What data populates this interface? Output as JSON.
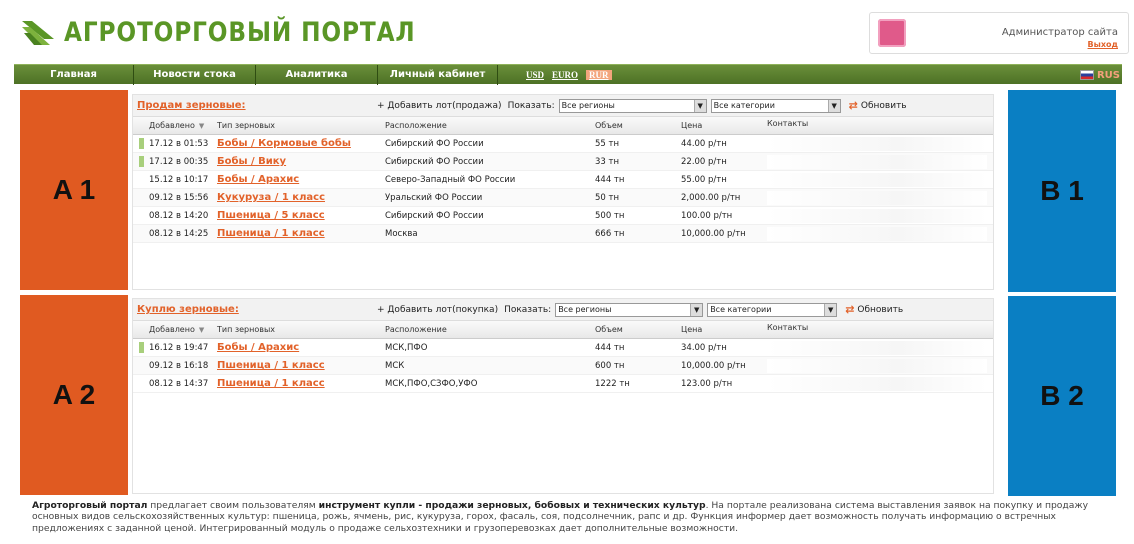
{
  "header": {
    "logo_text": "АГРОТОРГОВЫЙ ПОРТАЛ",
    "admin_name": "Администратор сайта",
    "logout": "Выход"
  },
  "nav": {
    "items": [
      "Главная",
      "Новости стока",
      "Аналитика",
      "Личный кабинет"
    ],
    "currencies": [
      "USD",
      "EURO",
      "RUR"
    ],
    "active_currency": "RUR",
    "language": "RUS"
  },
  "ads": {
    "a1": "A 1",
    "a2": "A 2",
    "b1": "B 1",
    "b2": "B 2"
  },
  "sell": {
    "title": "Продам зерновые:",
    "add_lot": "+ Добавить лот(продажа)",
    "show_label": "Показать:",
    "region_select": "Все регионы",
    "category_select": "Все категории",
    "refresh": "Обновить",
    "columns": [
      "Добавлено",
      "Тип зерновых",
      "Расположение",
      "Объем",
      "Цена",
      "Контакты"
    ],
    "rows": [
      {
        "date": "17.12 в 01:53",
        "type": "Бобы / Кормовые бобы",
        "location": "Сибирский ФО России",
        "volume": "55 тн",
        "price": "44.00 р/тн",
        "marked": true
      },
      {
        "date": "17.12 в 00:35",
        "type": "Бобы / Вику",
        "location": "Сибирский ФО России",
        "volume": "33 тн",
        "price": "22.00 р/тн",
        "marked": true
      },
      {
        "date": "15.12 в 10:17",
        "type": "Бобы / Арахис",
        "location": "Северо-Западный ФО России",
        "volume": "444 тн",
        "price": "55.00 р/тн",
        "marked": false
      },
      {
        "date": "09.12 в 15:56",
        "type": "Кукуруза / 1 класс",
        "location": "Уральский ФО России",
        "volume": "50 тн",
        "price": "2,000.00 р/тн",
        "marked": false
      },
      {
        "date": "08.12 в 14:20",
        "type": "Пшеница / 5 класс",
        "location": "Сибирский ФО России",
        "volume": "500 тн",
        "price": "100.00 р/тн",
        "marked": false
      },
      {
        "date": "08.12 в 14:25",
        "type": "Пшеница / 1 класс",
        "location": "Москва",
        "volume": "666 тн",
        "price": "10,000.00 р/тн",
        "marked": false
      }
    ]
  },
  "buy": {
    "title": "Куплю зерновые:",
    "add_lot": "+ Добавить лот(покупка)",
    "show_label": "Показать:",
    "region_select": "Все регионы",
    "category_select": "Все категории",
    "refresh": "Обновить",
    "columns": [
      "Добавлено",
      "Тип зерновых",
      "Расположение",
      "Объем",
      "Цена",
      "Контакты"
    ],
    "rows": [
      {
        "date": "16.12 в 19:47",
        "type": "Бобы / Арахис",
        "location": "МСК,ПФО",
        "volume": "444 тн",
        "price": "34.00 р/тн",
        "marked": true
      },
      {
        "date": "09.12 в 16:18",
        "type": "Пшеница / 1 класс",
        "location": "МСК",
        "volume": "600 тн",
        "price": "10,000.00 р/тн",
        "marked": false
      },
      {
        "date": "08.12 в 14:37",
        "type": "Пшеница / 1 класс",
        "location": "МСК,ПФО,СЗФО,УФО",
        "volume": "1222 тн",
        "price": "123.00 р/тн",
        "marked": false
      }
    ]
  },
  "footer": {
    "brand": "Агроторговый портал",
    "part1": " предлагает своим пользователям ",
    "bold1": "инструмент купли - продажи зерновых, бобовых и технических культур",
    "part2": ". На портале реализована система выставления заявок на покупку и продажу основных видов сельскохозяйственных культур: пшеница, рожь, ячмень, рис, кукуруза, горох, фасаль, соя, подсолнечник, рапс и др. Функция информер дает возможность получать информацию о встречных предложениях с заданной ценой. Интегрированный модуль о продаже сельхозтехники и грузоперевозках дает дополнительные возможности."
  },
  "colors": {
    "brand_green": "#5a9626",
    "accent_orange": "#e2622a",
    "ad_orange": "#e05a21",
    "ad_blue": "#0a7fc3"
  }
}
